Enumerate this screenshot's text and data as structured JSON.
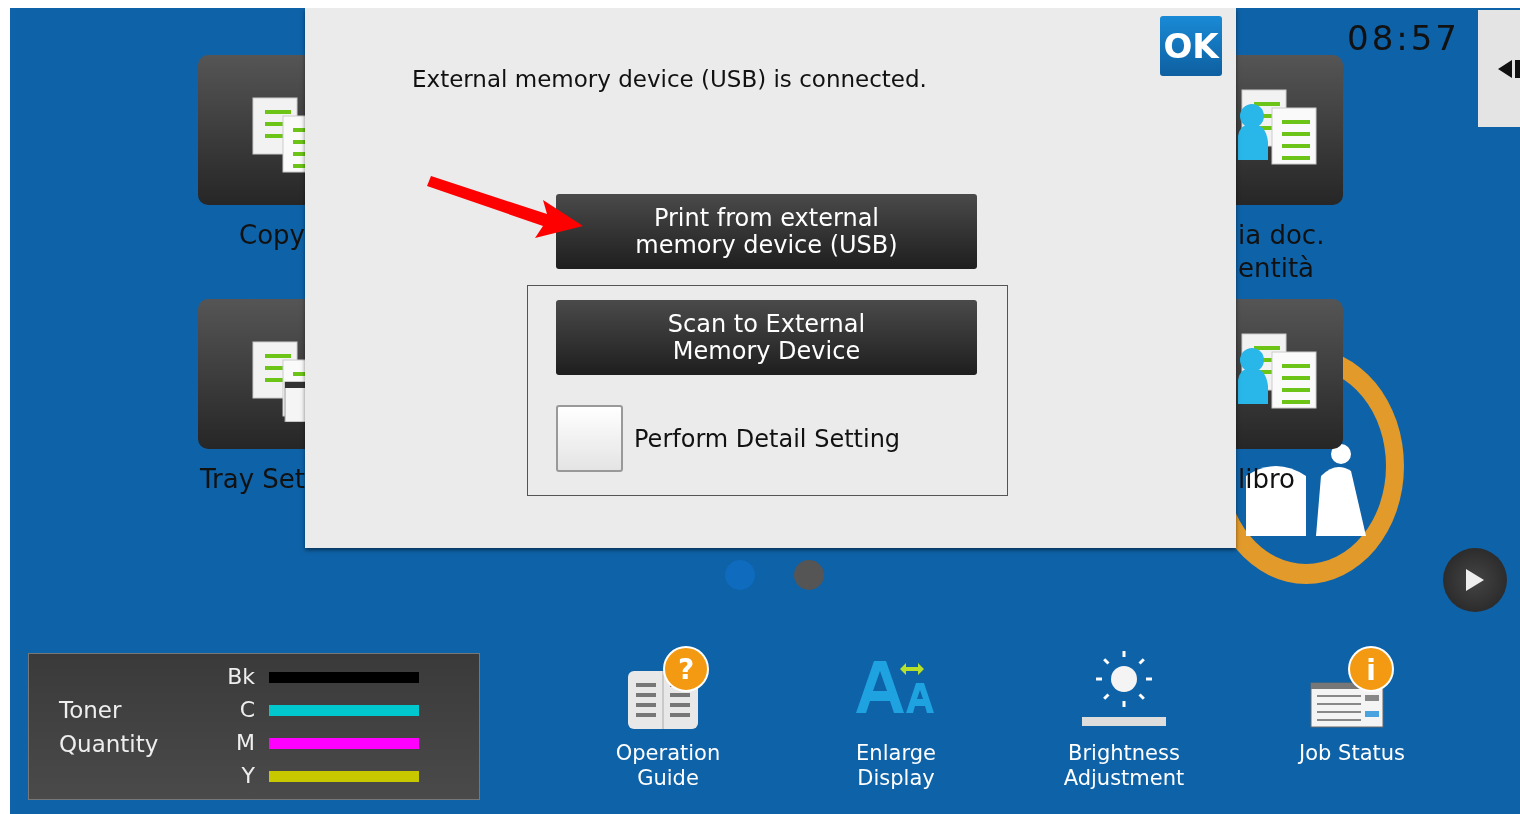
{
  "clock": "08:57",
  "tiles_left": [
    {
      "kind": "copy",
      "label": "Copy"
    },
    {
      "kind": "tray",
      "label": "Tray Set"
    }
  ],
  "tiles_right": [
    {
      "kind": "id_copy",
      "label": "ia doc.\nentità"
    },
    {
      "kind": "id_copy",
      "label": "libro"
    }
  ],
  "dialog": {
    "message": "External memory device (USB) is connected.",
    "ok_button": "OK",
    "print_button": "Print from external\nmemory device (USB)",
    "scan_button": "Scan to External\nMemory Device",
    "detail_checkbox": {
      "label": "Perform Detail Setting",
      "checked": false
    }
  },
  "page_dots": [
    {
      "selected": true
    },
    {
      "selected": false
    }
  ],
  "toner": {
    "title": "Toner\nQuantity",
    "colors": [
      {
        "label": "Bk",
        "color": "#000000",
        "level": 1
      },
      {
        "label": "C",
        "color": "#00c8cc",
        "level": 1
      },
      {
        "label": "M",
        "color": "#ff00ff",
        "level": 1
      },
      {
        "label": "Y",
        "color": "#c8c800",
        "level": 1
      }
    ]
  },
  "shortcuts": [
    {
      "kind": "guide",
      "badge": "?",
      "label": "Operation\nGuide"
    },
    {
      "kind": "enlarge",
      "label": "Enlarge\nDisplay"
    },
    {
      "kind": "brightness",
      "label": "Brightness\nAdjustment"
    },
    {
      "kind": "job",
      "badge": "i",
      "label": "Job Status"
    }
  ]
}
